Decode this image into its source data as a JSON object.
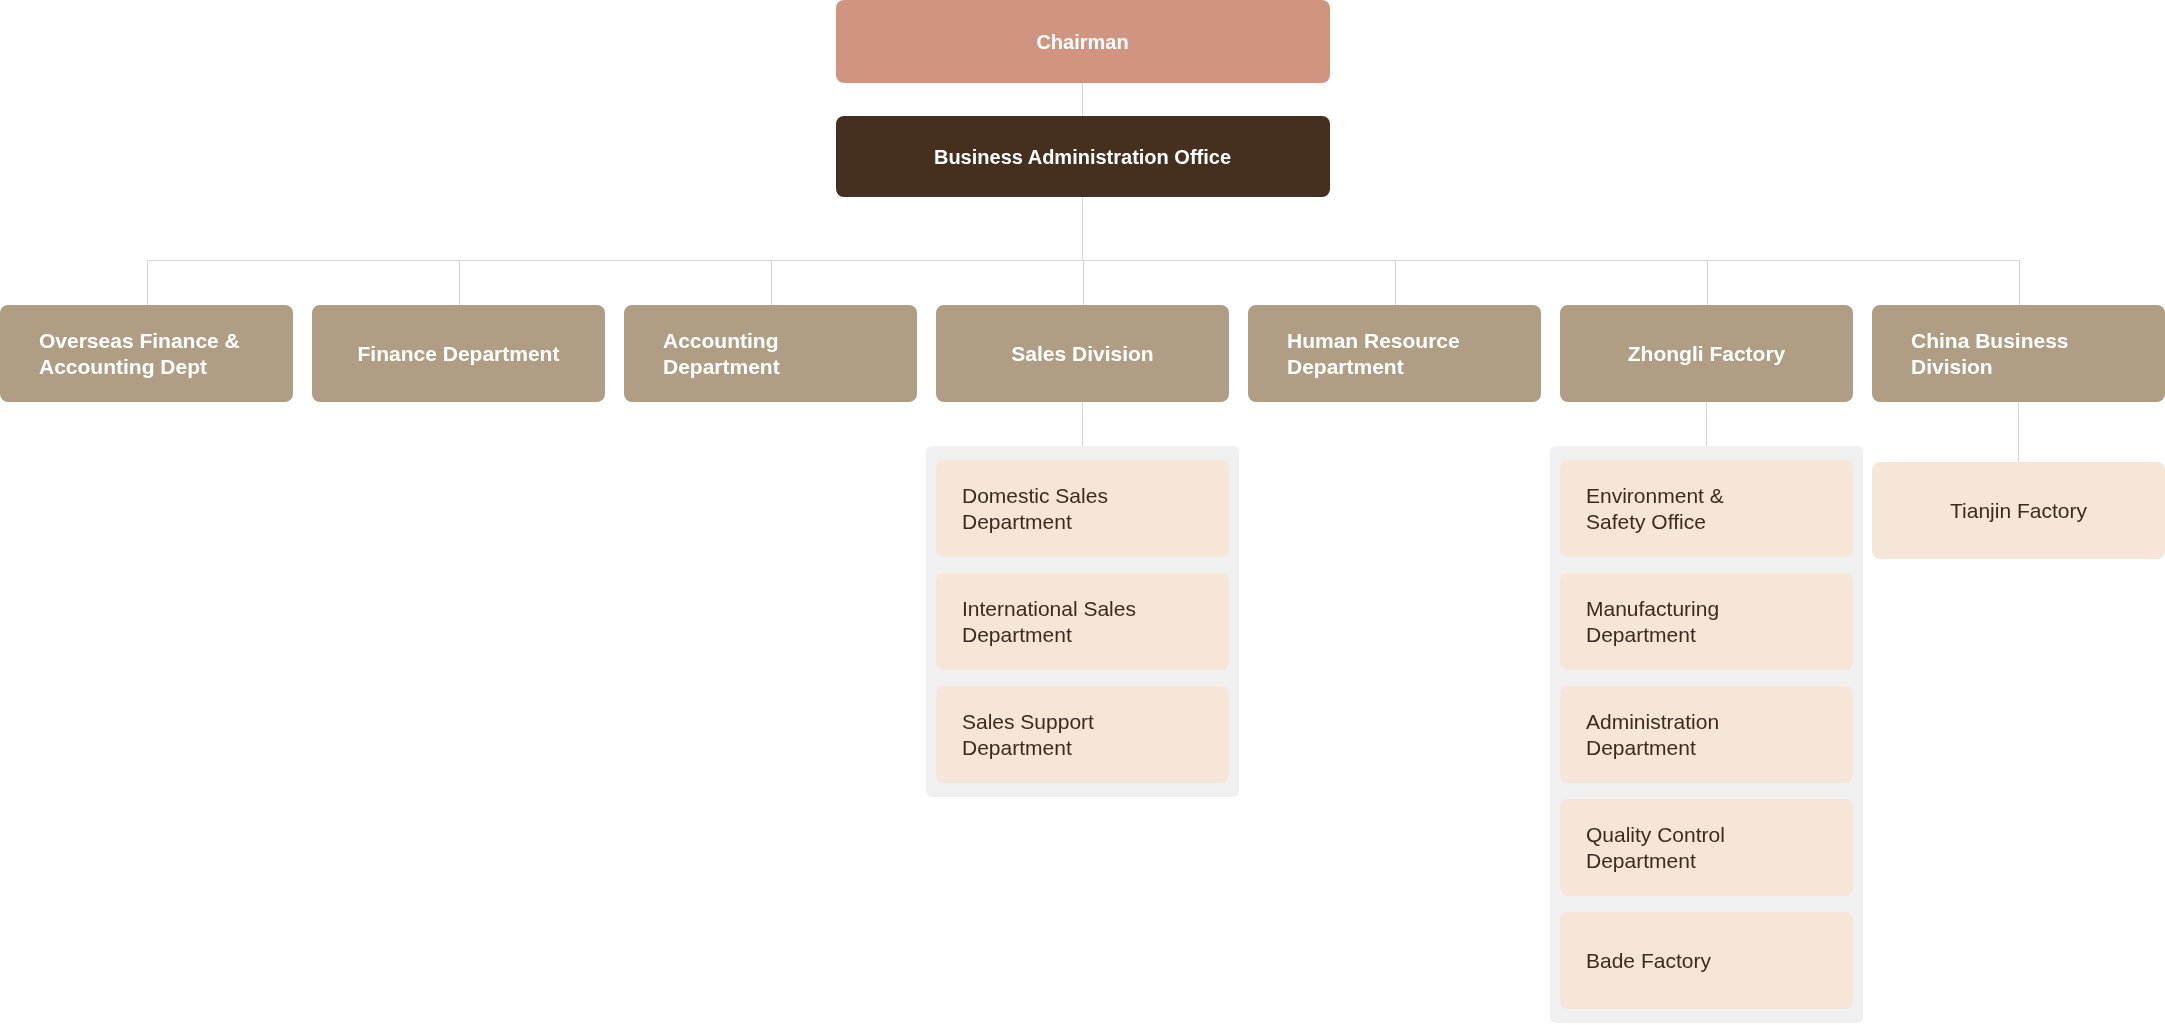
{
  "chairman": {
    "label": "Chairman"
  },
  "office": {
    "label": "Business Administration Office"
  },
  "divisions": [
    {
      "label": "Overseas Finance & Accounting Dept"
    },
    {
      "label": "Finance Department"
    },
    {
      "label": "Accounting Department"
    },
    {
      "label": "Sales Division",
      "children": [
        {
          "label": "Domestic Sales Department"
        },
        {
          "label": "International Sales Department"
        },
        {
          "label": "Sales Support Department"
        }
      ]
    },
    {
      "label": "Human Resource Department"
    },
    {
      "label": "Zhongli Factory",
      "children": [
        {
          "label": "Environment & Safety Office"
        },
        {
          "label": "Manufacturing Department"
        },
        {
          "label": "Administration Department"
        },
        {
          "label": "Quality Control Department"
        },
        {
          "label": "Bade Factory"
        }
      ]
    },
    {
      "label": "China Business Division",
      "children": [
        {
          "label": "Tianjin Factory"
        }
      ]
    }
  ]
}
